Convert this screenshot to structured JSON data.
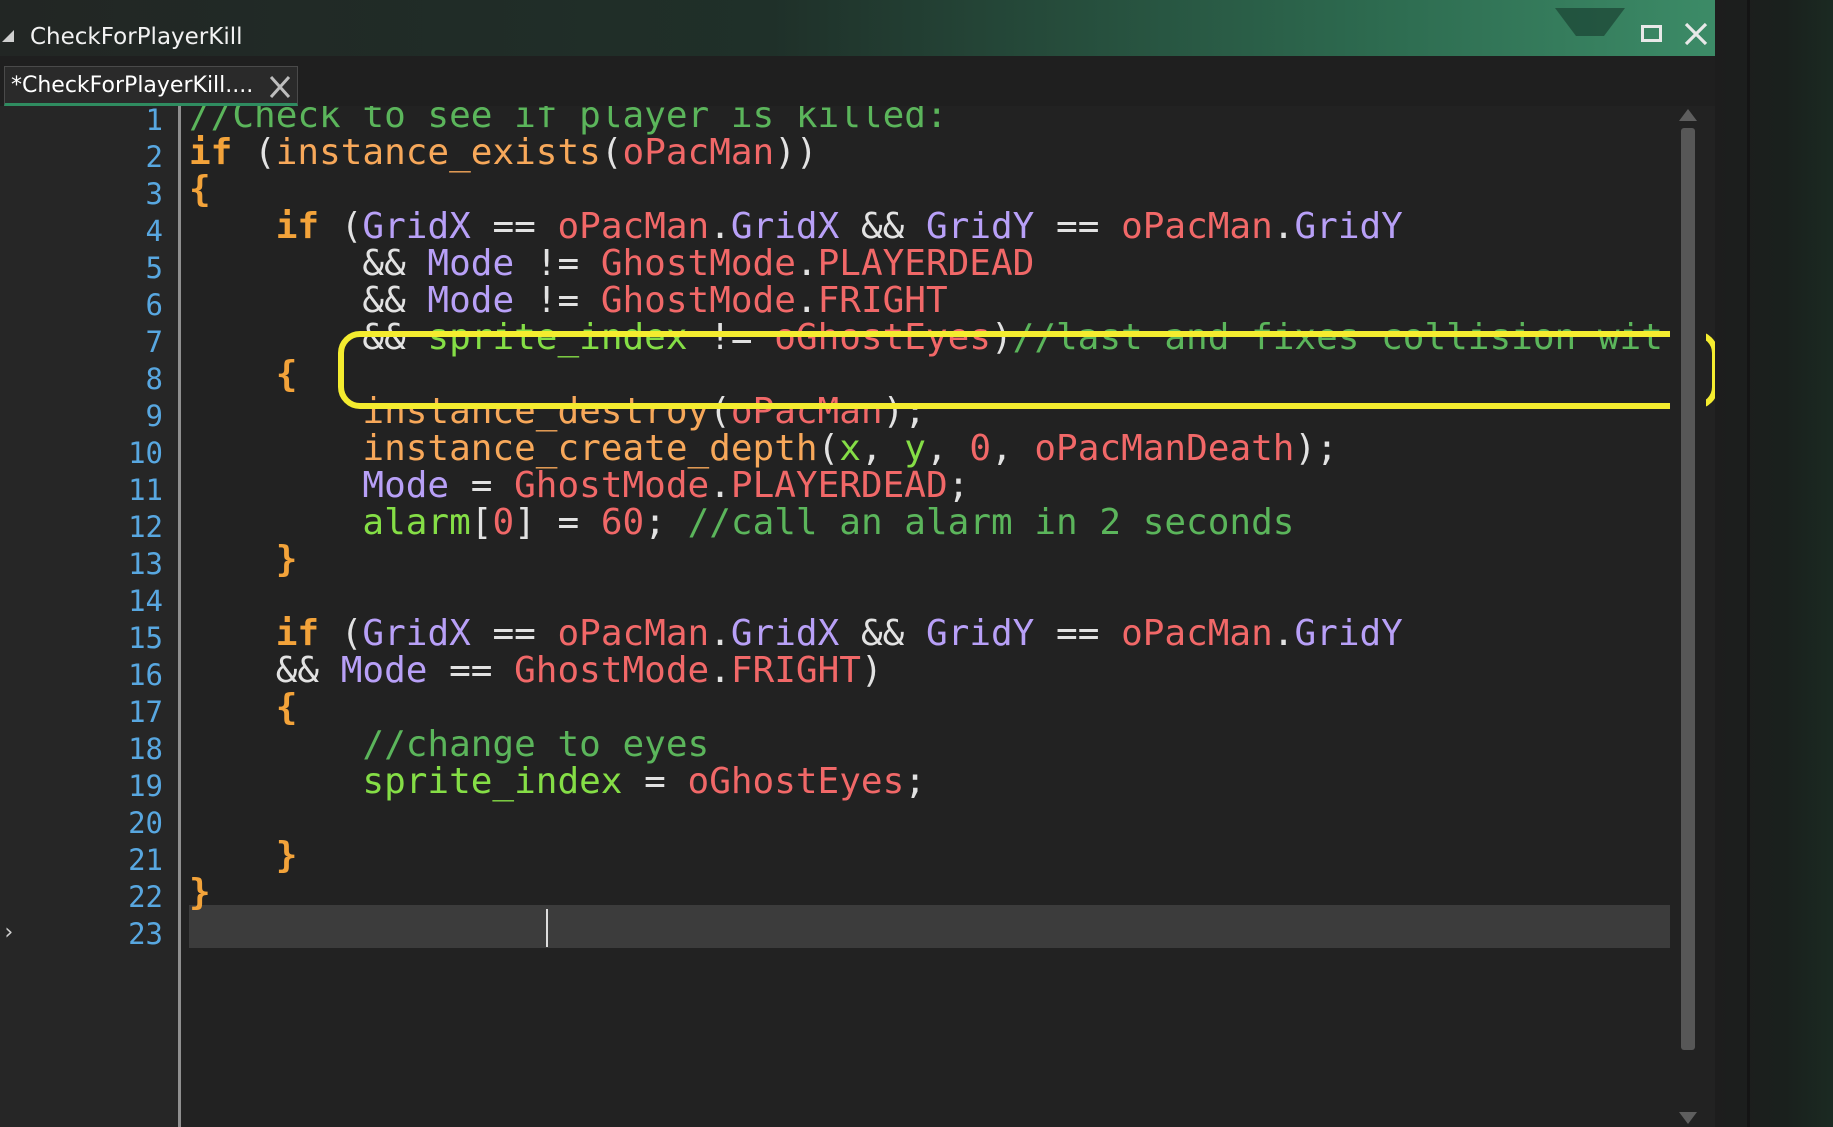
{
  "window": {
    "title": "CheckForPlayerKill"
  },
  "tab": {
    "label": "*CheckForPlayerKill...."
  },
  "editor": {
    "line_numbers": [
      "1",
      "2",
      "3",
      "4",
      "5",
      "6",
      "7",
      "8",
      "9",
      "10",
      "11",
      "12",
      "13",
      "14",
      "15",
      "16",
      "17",
      "18",
      "19",
      "20",
      "21",
      "22",
      "23"
    ],
    "current_line": 20,
    "highlighted_line": 7,
    "lines": [
      [
        {
          "t": "//Check to see if player is killed:",
          "c": "cm"
        }
      ],
      [
        {
          "t": "if",
          "c": "kw"
        },
        {
          "t": " (",
          "c": "op"
        },
        {
          "t": "instance_exists",
          "c": "fn"
        },
        {
          "t": "(",
          "c": "op"
        },
        {
          "t": "oPacMan",
          "c": "obj"
        },
        {
          "t": "))",
          "c": "op"
        }
      ],
      [
        {
          "t": "{",
          "c": "kw"
        }
      ],
      [
        {
          "t": "    ",
          "c": "op"
        },
        {
          "t": "if",
          "c": "kw"
        },
        {
          "t": " (",
          "c": "op"
        },
        {
          "t": "GridX",
          "c": "var"
        },
        {
          "t": " == ",
          "c": "op"
        },
        {
          "t": "oPacMan",
          "c": "obj"
        },
        {
          "t": ".",
          "c": "op"
        },
        {
          "t": "GridX",
          "c": "var"
        },
        {
          "t": " && ",
          "c": "op"
        },
        {
          "t": "GridY",
          "c": "var"
        },
        {
          "t": " == ",
          "c": "op"
        },
        {
          "t": "oPacMan",
          "c": "obj"
        },
        {
          "t": ".",
          "c": "op"
        },
        {
          "t": "GridY",
          "c": "var"
        }
      ],
      [
        {
          "t": "        && ",
          "c": "op"
        },
        {
          "t": "Mode",
          "c": "var"
        },
        {
          "t": " != ",
          "c": "op"
        },
        {
          "t": "GhostMode",
          "c": "obj"
        },
        {
          "t": ".",
          "c": "op"
        },
        {
          "t": "PLAYERDEAD",
          "c": "obj"
        }
      ],
      [
        {
          "t": "        && ",
          "c": "op"
        },
        {
          "t": "Mode",
          "c": "var"
        },
        {
          "t": " != ",
          "c": "op"
        },
        {
          "t": "GhostMode",
          "c": "obj"
        },
        {
          "t": ".",
          "c": "op"
        },
        {
          "t": "FRIGHT",
          "c": "obj"
        }
      ],
      [
        {
          "t": "        && ",
          "c": "op"
        },
        {
          "t": "sprite_index",
          "c": "bi"
        },
        {
          "t": " != ",
          "c": "op"
        },
        {
          "t": "oGhostEyes",
          "c": "obj"
        },
        {
          "t": ")",
          "c": "op"
        },
        {
          "t": "//last and fixes collision wit",
          "c": "cm"
        }
      ],
      [
        {
          "t": "    ",
          "c": "op"
        },
        {
          "t": "{",
          "c": "kw"
        }
      ],
      [
        {
          "t": "        ",
          "c": "op"
        },
        {
          "t": "instance_destroy",
          "c": "fn"
        },
        {
          "t": "(",
          "c": "op"
        },
        {
          "t": "oPacMan",
          "c": "obj"
        },
        {
          "t": ");",
          "c": "op"
        }
      ],
      [
        {
          "t": "        ",
          "c": "op"
        },
        {
          "t": "instance_create_depth",
          "c": "fn"
        },
        {
          "t": "(",
          "c": "op"
        },
        {
          "t": "x",
          "c": "bi"
        },
        {
          "t": ", ",
          "c": "op"
        },
        {
          "t": "y",
          "c": "bi"
        },
        {
          "t": ", ",
          "c": "op"
        },
        {
          "t": "0",
          "c": "num"
        },
        {
          "t": ", ",
          "c": "op"
        },
        {
          "t": "oPacManDeath",
          "c": "obj"
        },
        {
          "t": ");",
          "c": "op"
        }
      ],
      [
        {
          "t": "        ",
          "c": "op"
        },
        {
          "t": "Mode",
          "c": "var"
        },
        {
          "t": " = ",
          "c": "op"
        },
        {
          "t": "GhostMode",
          "c": "obj"
        },
        {
          "t": ".",
          "c": "op"
        },
        {
          "t": "PLAYERDEAD",
          "c": "obj"
        },
        {
          "t": ";",
          "c": "op"
        }
      ],
      [
        {
          "t": "        ",
          "c": "op"
        },
        {
          "t": "alarm",
          "c": "bi"
        },
        {
          "t": "[",
          "c": "op"
        },
        {
          "t": "0",
          "c": "num"
        },
        {
          "t": "] = ",
          "c": "op"
        },
        {
          "t": "60",
          "c": "num"
        },
        {
          "t": "; ",
          "c": "op"
        },
        {
          "t": "//call an alarm in 2 seconds",
          "c": "cm"
        }
      ],
      [
        {
          "t": "    ",
          "c": "op"
        },
        {
          "t": "}",
          "c": "kw"
        }
      ],
      [],
      [
        {
          "t": "    ",
          "c": "op"
        },
        {
          "t": "if",
          "c": "kw"
        },
        {
          "t": " (",
          "c": "op"
        },
        {
          "t": "GridX",
          "c": "var"
        },
        {
          "t": " == ",
          "c": "op"
        },
        {
          "t": "oPacMan",
          "c": "obj"
        },
        {
          "t": ".",
          "c": "op"
        },
        {
          "t": "GridX",
          "c": "var"
        },
        {
          "t": " && ",
          "c": "op"
        },
        {
          "t": "GridY",
          "c": "var"
        },
        {
          "t": " == ",
          "c": "op"
        },
        {
          "t": "oPacMan",
          "c": "obj"
        },
        {
          "t": ".",
          "c": "op"
        },
        {
          "t": "GridY",
          "c": "var"
        }
      ],
      [
        {
          "t": "    && ",
          "c": "op"
        },
        {
          "t": "Mode",
          "c": "var"
        },
        {
          "t": " == ",
          "c": "op"
        },
        {
          "t": "GhostMode",
          "c": "obj"
        },
        {
          "t": ".",
          "c": "op"
        },
        {
          "t": "FRIGHT",
          "c": "obj"
        },
        {
          "t": ")",
          "c": "op"
        }
      ],
      [
        {
          "t": "    ",
          "c": "op"
        },
        {
          "t": "{",
          "c": "kw"
        }
      ],
      [
        {
          "t": "        ",
          "c": "op"
        },
        {
          "t": "//change to eyes",
          "c": "cm"
        }
      ],
      [
        {
          "t": "        ",
          "c": "op"
        },
        {
          "t": "sprite_index",
          "c": "bi"
        },
        {
          "t": " = ",
          "c": "op"
        },
        {
          "t": "oGhostEyes",
          "c": "obj"
        },
        {
          "t": ";",
          "c": "op"
        }
      ],
      [],
      [
        {
          "t": "    ",
          "c": "op"
        },
        {
          "t": "}",
          "c": "kw"
        }
      ],
      [
        {
          "t": "}",
          "c": "kw"
        }
      ],
      []
    ]
  },
  "colors": {
    "keyword": "#f3a33a",
    "function": "#f7a85a",
    "object": "#f16868",
    "variable": "#b8a0f7",
    "builtin": "#85de46",
    "comment": "#5bb55b",
    "highlight_box": "#f4ec2f",
    "line_number": "#58a7e0"
  },
  "icons": {
    "collapse": "collapse-triangle-icon",
    "maximize": "maximize-icon",
    "close": "close-icon",
    "tab_close": "tab-close-icon",
    "fold": "chevron-right-icon"
  }
}
